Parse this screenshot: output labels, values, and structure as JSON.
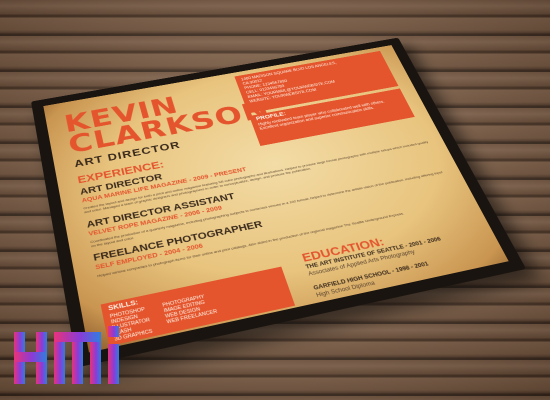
{
  "resume": {
    "name_line1": "KEVIN",
    "name_line2": "CLARKSON",
    "role": "ART DIRECTOR",
    "contact": [
      "1480 MADISON SQUARE BLVD LOS ANGELES,",
      "CA 90012",
      "PHONE: 1234567890",
      "CELL: 0123456789",
      "EMAIL: YOURMAIL@YOURWEBSITE.COM",
      "WEBSITE: YOURWEBSITE.COM"
    ],
    "profile_title": "PROFILE:",
    "profile_text": "Highly motivated team player who collaborated well with others. Excellent organization and superior communication skills.",
    "experience_head": "EXPERIENCE:",
    "jobs": [
      {
        "title": "ART DIRECTOR",
        "sub": "AQUA MARINE LIFE MAGAZINE - 2009 - PRESENT",
        "desc": "Created the layout and design for both a print and online magazine featuring full color photographs and illustrations. Helped to produce large format photographs with multiple setups which included quality and color. Managed a team of graphic designers and photographers in order to conceptualize, design, and produce the publication."
      },
      {
        "title": "ART DIRECTOR ASSISTANT",
        "sub": "VELVET ROPE MAGAZINE - 2006 - 2009",
        "desc": "Coordinated the production of a quarterly magazine, including photographing subjects in numerous venues in a 100 format; helped to determine the artistic vision of the publication, including offering input on the layout and color."
      },
      {
        "title": "FREELANCE PHOTOGRAPHER",
        "sub": "SELF EMPLOYED - 2004 - 2006",
        "desc": "Helped various companies to photograph items for their online and print catalogs. Also aided in the production of the regional magazine The Seattle Underground Express."
      }
    ],
    "education_head": "EDUCATION:",
    "education": [
      {
        "school": "THE ART INSTITUTE OF SEATTLE - 2001 - 2006",
        "degree": "Associates of Applied Arts Photography"
      },
      {
        "school": "GARFIELD HIGH SCHOOL - 1998 - 2001",
        "degree": "High School Diploma"
      }
    ],
    "skills_title": "SKILLS:",
    "skills_left": [
      "PHOTOSHOP",
      "INDESIGN",
      "ILLUSTRATOR",
      "FLASH",
      "3D GRAPHICS"
    ],
    "skills_right": [
      "PHOTOGRAPHY",
      "IMAGE EDITING",
      "WEB DESIGN",
      "WEB FREELANCER"
    ]
  },
  "colors": {
    "accent": "#e4552e",
    "ink": "#3a2a1c",
    "paper": "#e8c47e"
  },
  "logo": {
    "colors": [
      "#e8337a",
      "#8a3bd8",
      "#2f7fe0"
    ]
  }
}
